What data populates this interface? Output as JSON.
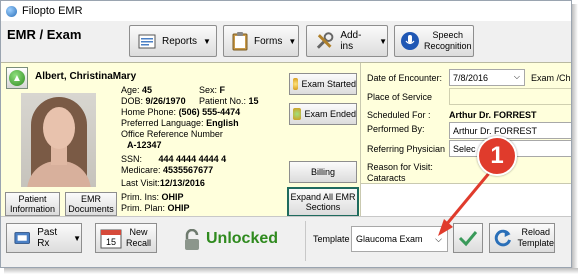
{
  "window": {
    "title": "Filopto EMR"
  },
  "module": {
    "title": "EMR / Exam"
  },
  "toolbar": {
    "reports_label": "Reports",
    "forms_label": "Forms",
    "addins_label": "Add-ins",
    "speech_label_1": "Speech",
    "speech_label_2": "Recognition"
  },
  "patient": {
    "name": "Albert, ChristinaMary",
    "age_label": "Age:",
    "age": "45",
    "sex_label": "Sex:",
    "sex": "F",
    "dob_label": "DOB:",
    "dob": "9/26/1970",
    "patient_no_label": "Patient No.:",
    "patient_no": "15",
    "home_phone_label": "Home Phone:",
    "home_phone": "(506) 555-4474",
    "pref_lang_label": "Preferred Language:",
    "pref_lang": "English",
    "office_ref_label": "Office Reference Number",
    "office_ref": "A-12347",
    "ssn_label": "SSN:",
    "ssn": "444 4444 4444 4",
    "medicare_label": "Medicare:",
    "medicare": "4535567677",
    "last_visit_label": "Last Visit:",
    "last_visit": "12/13/2016",
    "prim_ins_label": "Prim. Ins:",
    "prim_ins": "OHIP",
    "prim_plan_label": "Prim. Plan:",
    "prim_plan": "OHIP"
  },
  "side_buttons": {
    "patient_info_1": "Patient",
    "patient_info_2": "Information",
    "emr_docs_1": "EMR",
    "emr_docs_2": "Documents"
  },
  "encounter_buttons": {
    "started": "Exam Started",
    "ended": "Exam Ended",
    "billing": "Billing",
    "expand_1": "Expand All EMR",
    "expand_2": "Sections"
  },
  "encounter": {
    "date_label": "Date of Encounter:",
    "date_value": "7/8/2016",
    "exam_type_partial": "Exam /Ch",
    "place_label": "Place of Service",
    "scheduled_label": "Scheduled For :",
    "scheduled_value": "Arthur Dr. FORREST",
    "performed_label": "Performed By:",
    "performed_value": "Arthur  Dr. FORREST",
    "referring_label": "Referring Physician",
    "referring_value": "Selec",
    "reason_label": "Reason for Visit:",
    "reason_value": "Cataracts"
  },
  "bottom": {
    "past_rx_label": "Past Rx",
    "new_recall_1": "New",
    "new_recall_2": "Recall",
    "lock_status": "Unlocked",
    "template_label": "Template",
    "template_value": "Glaucoma Exam",
    "reload_1": "Reload",
    "reload_2": "Template",
    "calendar_day": "15"
  },
  "callout": {
    "number": "1"
  },
  "colors": {
    "content_bg": "#ffffdc",
    "unlocked_green": "#2f8a1e",
    "callout_red": "#e03b2c",
    "expand_border": "#1f6b5e"
  }
}
